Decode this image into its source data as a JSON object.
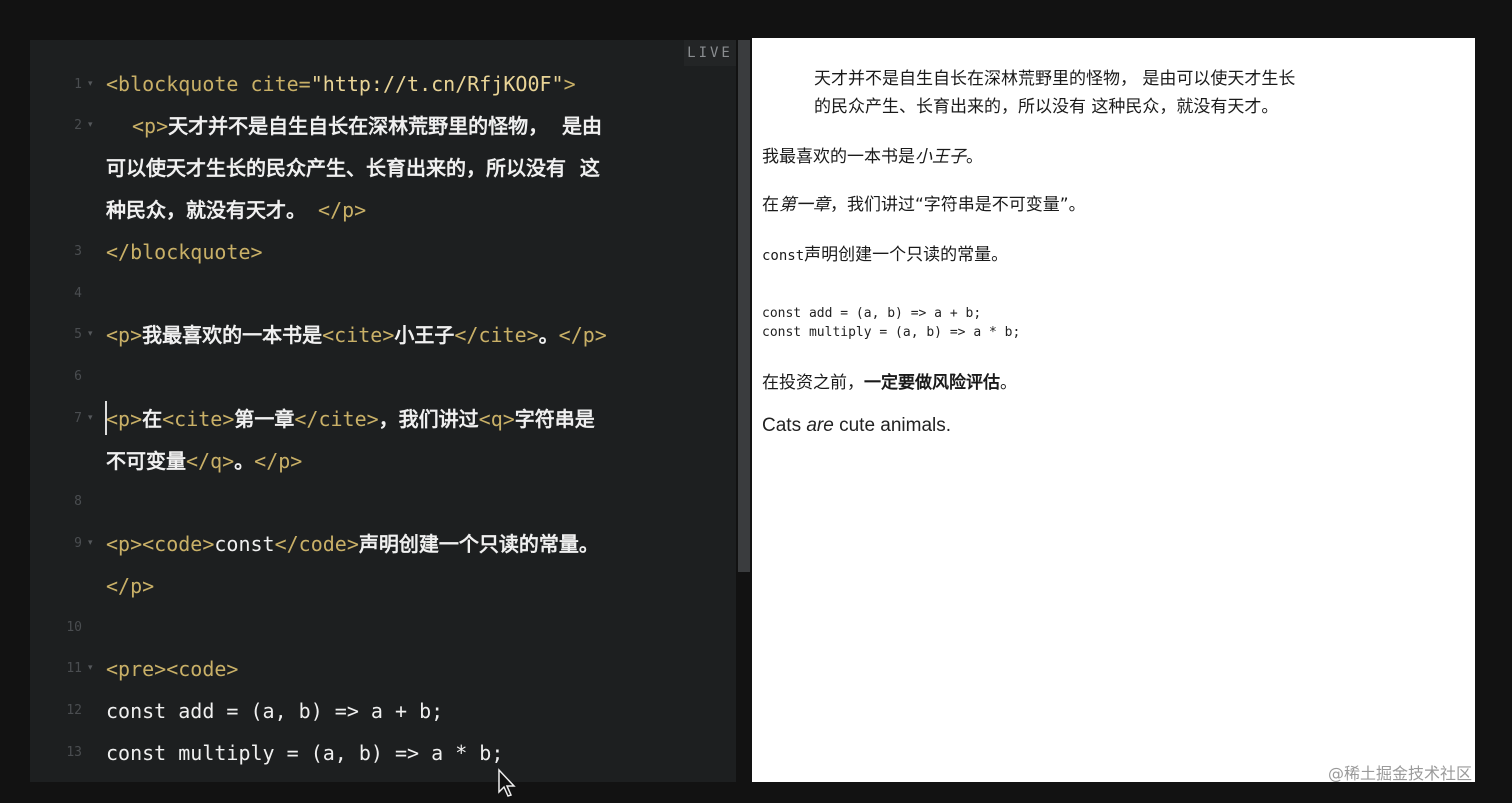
{
  "editor": {
    "live_label": "LIVE",
    "line_numbers": [
      "1",
      "2",
      "3",
      "4",
      "5",
      "6",
      "7",
      "8",
      "9",
      "10",
      "11",
      "12",
      "13"
    ],
    "code": {
      "bq_open_tag": "<blockquote",
      "bq_attr": " cite=",
      "bq_attr_value": "\"http://t.cn/RfjKO0F\"",
      "bq_close_bracket": ">",
      "p_open": "<p>",
      "quote_line1": "天才并不是自生自长在深林荒野里的怪物，  是由",
      "quote_line2": "可以使天才生长的民众产生、长育出来的，所以没有  这",
      "quote_line3": "种民众，就没有天才。",
      "p_close": "</p>",
      "bq_close": "</blockquote>",
      "line5_text": "我最喜欢的一本书是",
      "cite_open": "<cite>",
      "line5_cite": "小王子",
      "cite_close": "</cite>",
      "line5_end": "。",
      "line7_text": "在",
      "line7_cite": "第一章",
      "line7_mid": "，我们讲过",
      "q_open": "<q>",
      "line7_q1": "字符串是",
      "line7_q2": "不可变量",
      "q_close": "</q>",
      "line7_end": "。",
      "code_open": "<code>",
      "line9_code": "const",
      "code_close": "</code>",
      "line9_text": "声明创建一个只读的常量。",
      "pre_code_open": "<pre><code>",
      "line12": "const add = (a, b) => a + b;",
      "line13": "const multiply = (a, b) => a * b;"
    }
  },
  "preview": {
    "blockquote_line1": "天才并不是自生自长在深林荒野里的怪物，  是由可以使天才生长",
    "blockquote_line2": "的民众产生、长育出来的，所以没有  这种民众，就没有天才。",
    "p1_text": "我最喜欢的一本书是",
    "p1_cite": "小王子",
    "p1_end": "。",
    "p2_text": "在",
    "p2_cite": "第一章",
    "p2_mid": "，我们讲过",
    "p2_quote": "“字符串是不可变量”",
    "p2_end": "。",
    "p3_code": "const",
    "p3_text": "声明创建一个只读的常量。",
    "pre_line1": "const add = (a, b) => a + b;",
    "pre_line2": "const multiply = (a, b) => a * b;",
    "p4_text": "在投资之前，",
    "p4_strong": "一定要做风险评估",
    "p4_end": "。",
    "p5_a": "Cats ",
    "p5_em": "are",
    "p5_b": " cute animals."
  },
  "watermark": "@稀土掘金技术社区"
}
